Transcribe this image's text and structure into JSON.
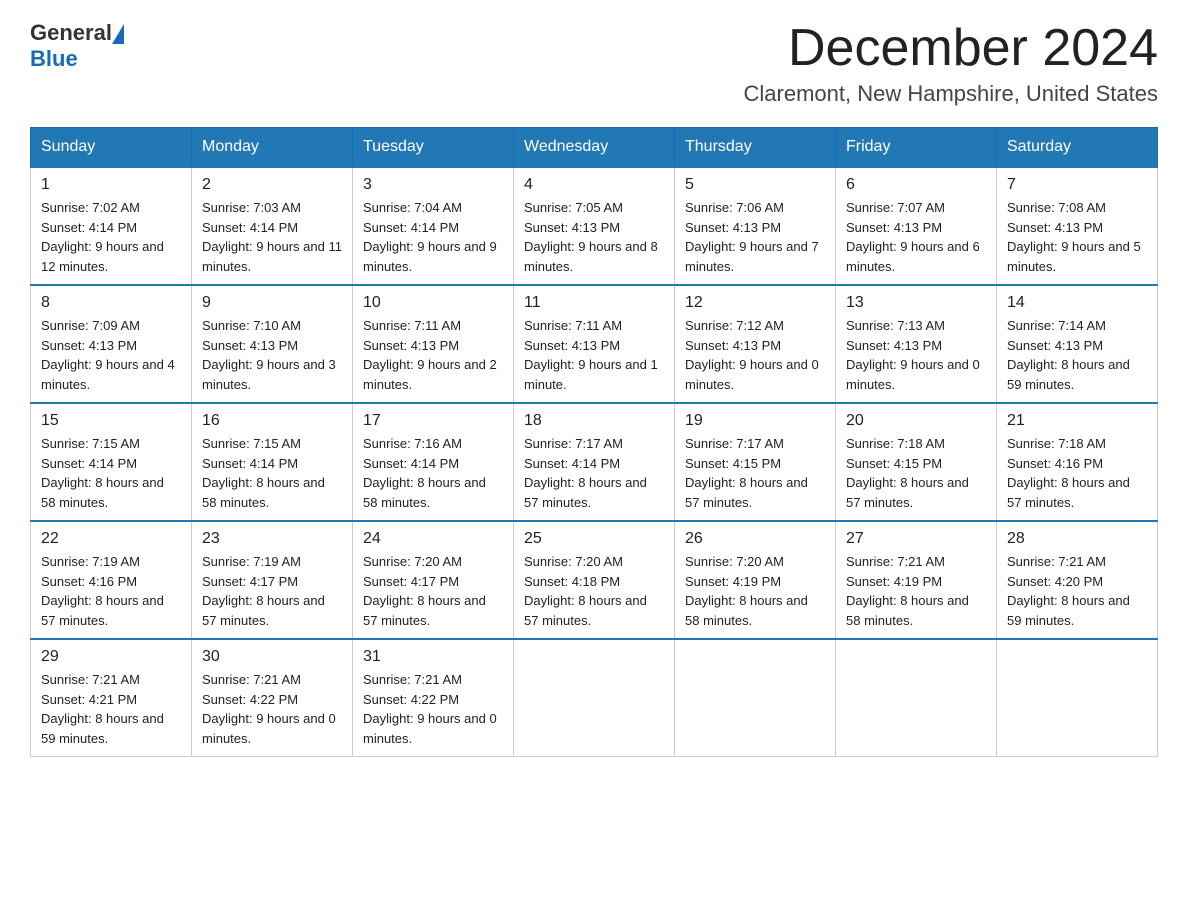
{
  "header": {
    "logo_general": "General",
    "logo_blue": "Blue",
    "month_title": "December 2024",
    "location": "Claremont, New Hampshire, United States"
  },
  "days_of_week": [
    "Sunday",
    "Monday",
    "Tuesday",
    "Wednesday",
    "Thursday",
    "Friday",
    "Saturday"
  ],
  "weeks": [
    [
      {
        "day": "1",
        "sunrise": "7:02 AM",
        "sunset": "4:14 PM",
        "daylight": "9 hours and 12 minutes."
      },
      {
        "day": "2",
        "sunrise": "7:03 AM",
        "sunset": "4:14 PM",
        "daylight": "9 hours and 11 minutes."
      },
      {
        "day": "3",
        "sunrise": "7:04 AM",
        "sunset": "4:14 PM",
        "daylight": "9 hours and 9 minutes."
      },
      {
        "day": "4",
        "sunrise": "7:05 AM",
        "sunset": "4:13 PM",
        "daylight": "9 hours and 8 minutes."
      },
      {
        "day": "5",
        "sunrise": "7:06 AM",
        "sunset": "4:13 PM",
        "daylight": "9 hours and 7 minutes."
      },
      {
        "day": "6",
        "sunrise": "7:07 AM",
        "sunset": "4:13 PM",
        "daylight": "9 hours and 6 minutes."
      },
      {
        "day": "7",
        "sunrise": "7:08 AM",
        "sunset": "4:13 PM",
        "daylight": "9 hours and 5 minutes."
      }
    ],
    [
      {
        "day": "8",
        "sunrise": "7:09 AM",
        "sunset": "4:13 PM",
        "daylight": "9 hours and 4 minutes."
      },
      {
        "day": "9",
        "sunrise": "7:10 AM",
        "sunset": "4:13 PM",
        "daylight": "9 hours and 3 minutes."
      },
      {
        "day": "10",
        "sunrise": "7:11 AM",
        "sunset": "4:13 PM",
        "daylight": "9 hours and 2 minutes."
      },
      {
        "day": "11",
        "sunrise": "7:11 AM",
        "sunset": "4:13 PM",
        "daylight": "9 hours and 1 minute."
      },
      {
        "day": "12",
        "sunrise": "7:12 AM",
        "sunset": "4:13 PM",
        "daylight": "9 hours and 0 minutes."
      },
      {
        "day": "13",
        "sunrise": "7:13 AM",
        "sunset": "4:13 PM",
        "daylight": "9 hours and 0 minutes."
      },
      {
        "day": "14",
        "sunrise": "7:14 AM",
        "sunset": "4:13 PM",
        "daylight": "8 hours and 59 minutes."
      }
    ],
    [
      {
        "day": "15",
        "sunrise": "7:15 AM",
        "sunset": "4:14 PM",
        "daylight": "8 hours and 58 minutes."
      },
      {
        "day": "16",
        "sunrise": "7:15 AM",
        "sunset": "4:14 PM",
        "daylight": "8 hours and 58 minutes."
      },
      {
        "day": "17",
        "sunrise": "7:16 AM",
        "sunset": "4:14 PM",
        "daylight": "8 hours and 58 minutes."
      },
      {
        "day": "18",
        "sunrise": "7:17 AM",
        "sunset": "4:14 PM",
        "daylight": "8 hours and 57 minutes."
      },
      {
        "day": "19",
        "sunrise": "7:17 AM",
        "sunset": "4:15 PM",
        "daylight": "8 hours and 57 minutes."
      },
      {
        "day": "20",
        "sunrise": "7:18 AM",
        "sunset": "4:15 PM",
        "daylight": "8 hours and 57 minutes."
      },
      {
        "day": "21",
        "sunrise": "7:18 AM",
        "sunset": "4:16 PM",
        "daylight": "8 hours and 57 minutes."
      }
    ],
    [
      {
        "day": "22",
        "sunrise": "7:19 AM",
        "sunset": "4:16 PM",
        "daylight": "8 hours and 57 minutes."
      },
      {
        "day": "23",
        "sunrise": "7:19 AM",
        "sunset": "4:17 PM",
        "daylight": "8 hours and 57 minutes."
      },
      {
        "day": "24",
        "sunrise": "7:20 AM",
        "sunset": "4:17 PM",
        "daylight": "8 hours and 57 minutes."
      },
      {
        "day": "25",
        "sunrise": "7:20 AM",
        "sunset": "4:18 PM",
        "daylight": "8 hours and 57 minutes."
      },
      {
        "day": "26",
        "sunrise": "7:20 AM",
        "sunset": "4:19 PM",
        "daylight": "8 hours and 58 minutes."
      },
      {
        "day": "27",
        "sunrise": "7:21 AM",
        "sunset": "4:19 PM",
        "daylight": "8 hours and 58 minutes."
      },
      {
        "day": "28",
        "sunrise": "7:21 AM",
        "sunset": "4:20 PM",
        "daylight": "8 hours and 59 minutes."
      }
    ],
    [
      {
        "day": "29",
        "sunrise": "7:21 AM",
        "sunset": "4:21 PM",
        "daylight": "8 hours and 59 minutes."
      },
      {
        "day": "30",
        "sunrise": "7:21 AM",
        "sunset": "4:22 PM",
        "daylight": "9 hours and 0 minutes."
      },
      {
        "day": "31",
        "sunrise": "7:21 AM",
        "sunset": "4:22 PM",
        "daylight": "9 hours and 0 minutes."
      },
      null,
      null,
      null,
      null
    ]
  ],
  "labels": {
    "sunrise": "Sunrise:",
    "sunset": "Sunset:",
    "daylight": "Daylight:"
  }
}
